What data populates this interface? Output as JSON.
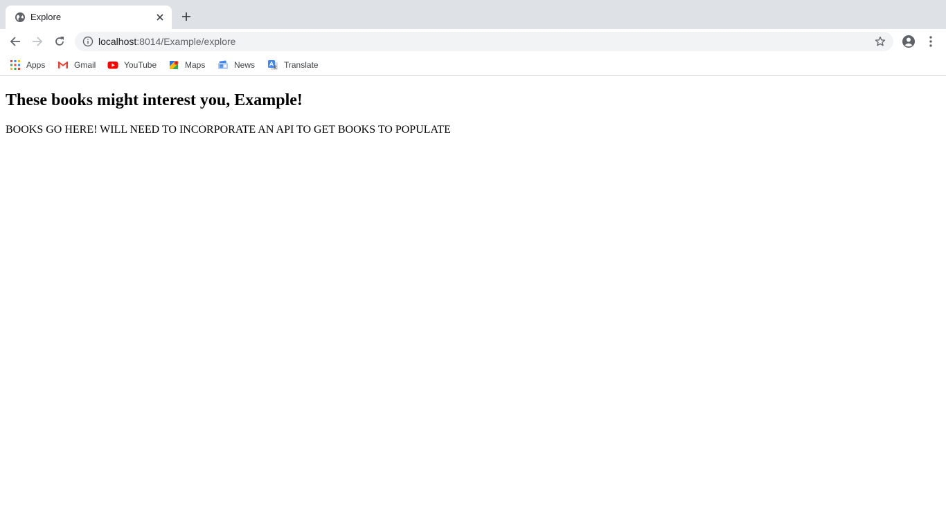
{
  "browser": {
    "tab": {
      "title": "Explore",
      "favicon": "globe-icon"
    },
    "address": {
      "host": "localhost",
      "path": ":8014/Example/explore"
    },
    "bookmarks": [
      {
        "label": "Apps",
        "icon": "apps-grid-icon"
      },
      {
        "label": "Gmail",
        "icon": "gmail-icon"
      },
      {
        "label": "YouTube",
        "icon": "youtube-icon"
      },
      {
        "label": "Maps",
        "icon": "maps-icon"
      },
      {
        "label": "News",
        "icon": "news-icon"
      },
      {
        "label": "Translate",
        "icon": "translate-icon"
      }
    ],
    "colors": {
      "tabstrip": "#dee1e6",
      "omnibox": "#f1f3f4"
    }
  },
  "page": {
    "heading": "These books might interest you, Example!",
    "body": "BOOKS GO HERE! WILL NEED TO INCORPORATE AN API TO GET BOOKS TO POPULATE"
  }
}
